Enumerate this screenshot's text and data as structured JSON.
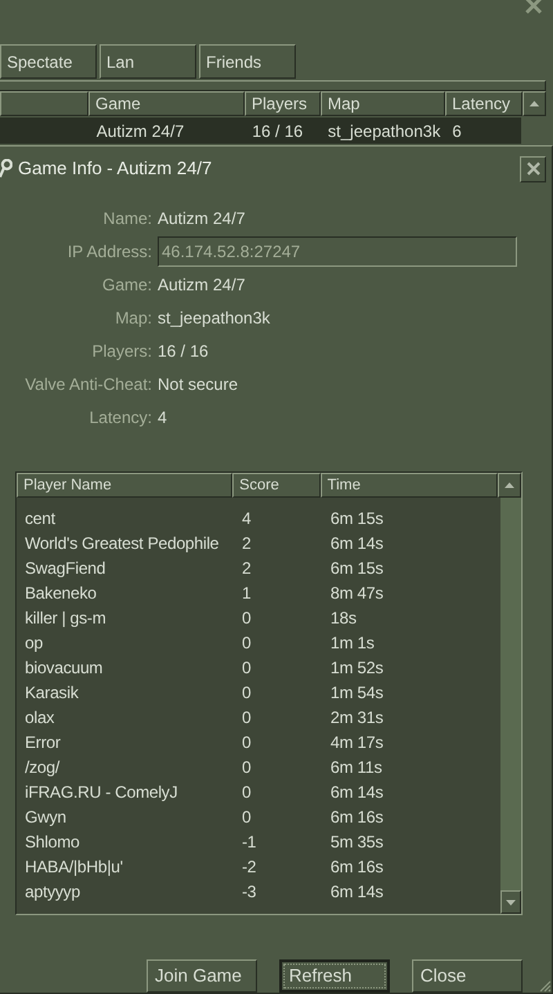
{
  "tabs": [
    {
      "label": "Spectate",
      "selected": false
    },
    {
      "label": "Lan",
      "selected": false
    },
    {
      "label": "Friends",
      "selected": false
    }
  ],
  "server_list": {
    "columns": [
      "Game",
      "Players",
      "Map",
      "Latency"
    ],
    "rows": [
      {
        "cells": [
          "Autizm 24/7",
          "16 / 16",
          "st_jeepathon3k",
          "6"
        ],
        "selected": true
      }
    ]
  },
  "dialog": {
    "title": "Game Info - Autizm 24/7",
    "fields": [
      {
        "kind": "text",
        "label": "Name:",
        "value": "Autizm 24/7"
      },
      {
        "kind": "input",
        "label": "IP Address:",
        "value": "46.174.52.8:27247"
      },
      {
        "kind": "text",
        "label": "Game:",
        "value": "Autizm 24/7"
      },
      {
        "kind": "text",
        "label": "Map:",
        "value": "st_jeepathon3k"
      },
      {
        "kind": "text",
        "label": "Players:",
        "value": "16 / 16"
      },
      {
        "kind": "text",
        "label": "Valve Anti-Cheat:",
        "value": "Not secure"
      },
      {
        "kind": "text",
        "label": "Latency:",
        "value": "4"
      }
    ],
    "players": {
      "columns": [
        "Player Name",
        "Score",
        "Time"
      ],
      "rows": [
        [
          "cent",
          "4",
          "6m 15s"
        ],
        [
          "World's Greatest Pedophile",
          "2",
          "6m 14s"
        ],
        [
          "SwagFiend",
          "2",
          "6m 15s"
        ],
        [
          "Bakeneko",
          "1",
          "8m 47s"
        ],
        [
          "killer | gs-m",
          "0",
          "18s"
        ],
        [
          "op",
          "0",
          "1m 1s"
        ],
        [
          "biovacuum",
          "0",
          "1m 52s"
        ],
        [
          "Karasik",
          "0",
          "1m 54s"
        ],
        [
          "olax",
          "0",
          "2m 31s"
        ],
        [
          "Error",
          "0",
          "4m 17s"
        ],
        [
          "/zog/",
          "0",
          "6m 11s"
        ],
        [
          "iFRAG.RU - ComelyJ",
          "0",
          "6m 14s"
        ],
        [
          "Gwyn",
          "0",
          "6m 16s"
        ],
        [
          "Shlomo",
          "-1",
          "5m 35s"
        ],
        [
          "HABA/|bHb|u'",
          "-2",
          "6m 16s"
        ],
        [
          "aptyyyp",
          "-3",
          "6m 14s"
        ]
      ]
    },
    "buttons": [
      {
        "label": "Join Game",
        "focused": false
      },
      {
        "label": "Refresh",
        "focused": true
      },
      {
        "label": "Close",
        "focused": false
      }
    ]
  }
}
